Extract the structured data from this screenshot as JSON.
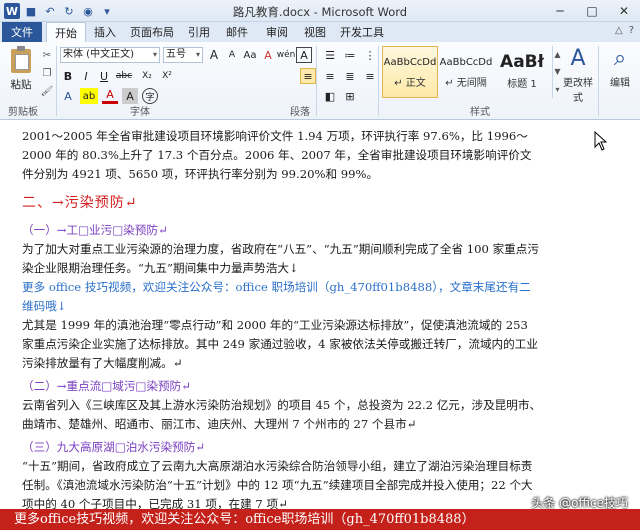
{
  "window": {
    "title": "路凡教育.docx - Microsoft Word",
    "minimize": "─",
    "maximize": "□",
    "close": "✕"
  },
  "tabs": [
    "文件",
    "开始",
    "插入",
    "页面布局",
    "引用",
    "邮件",
    "审阅",
    "视图",
    "开发工具"
  ],
  "ribbon": {
    "clipboard": {
      "paste": "粘贴",
      "group": "剪贴板"
    },
    "font": {
      "family": "宋体 (中文正文)",
      "size": "五号",
      "group": "字体",
      "bold": "B",
      "italic": "I",
      "underline": "U",
      "grow": "A",
      "shrink": "A",
      "aa": "Aa",
      "clear": "A",
      "wen": "wén",
      "char_border": "A",
      "strike": "abc",
      "sub": "X₂",
      "sup": "X²",
      "font_color": "A",
      "highlight": "ab",
      "char_shade": "A",
      "enclose": "字"
    },
    "paragraph": {
      "group": "段落"
    },
    "styles": {
      "group": "样式",
      "items": [
        {
          "sample": "AaBbCcDd",
          "name": "↵ 正文"
        },
        {
          "sample": "AaBbCcDd",
          "name": "↵ 无间隔"
        },
        {
          "sample": "AaBł",
          "name": "标题 1"
        }
      ],
      "change": "更改样式"
    },
    "editing": {
      "label": "编辑"
    }
  },
  "document": {
    "p1": "2001～2005 年全省审批建设项目环境影响评价文件 1.94 万项，环评执行率 97.6%，比 1996～2000 年的 80.3%上升了 17.3 个百分点。2006 年、2007 年，全省审批建设项目环境影响评价文件分别为 4921 项、5650 项，环评执行率分别为 99.20%和 99%。",
    "h2": "二、→污染预防↵",
    "h3a": "（一）→工□业污□染预防↵",
    "p2": "为了加大对重点工业污染源的治理力度，省政府在“八五”、“九五”期间顺利完成了全省 100 家重点污染企业限期治理任务。“九五”期间集中力量声势浩大↓",
    "link": "更多 office 技巧视频，欢迎关注公众号：office 职场培训（gh_470ff01b8488），文章末尾还有二维码哦↓",
    "p3": "尤其是 1999 年的滇池治理“零点行动”和 2000 年的“工业污染源达标排放”，促使滇池流域的 253 家重点污染企业实施了达标排放。其中 249 家通过验收，4 家被依法关停或搬迁转厂，流域内的工业污染排放量有了大幅度削减。↵",
    "h3b": "（二）→重点流□域污□染预防↵",
    "p4": "云南省列入《三峡库区及其上游水污染防治规划》的项目 45 个，总投资为 22.2 亿元，涉及昆明市、曲靖市、楚雄州、昭通市、丽江市、迪庆州、大理州 7 个州市的 27 个县市↵",
    "h3c": "（三）九大高原湖□泊水污染预防↵",
    "p5": "“十五”期间，省政府成立了云南九大高原湖泊水污染综合防治领导小组，建立了湖泊污染治理目标责任制。《滇池流域水污染防治“十五”计划》中的 12 项“九五”续建项目全部完成并投入使用；22 个大项中的 40 个子项目中，已完成 31 项，在建 7 项↵"
  },
  "banner": "更多office技巧视频，欢迎关注公众号：office职场培训（gh_470ff01b8488）",
  "watermark": "头条 @office技巧"
}
